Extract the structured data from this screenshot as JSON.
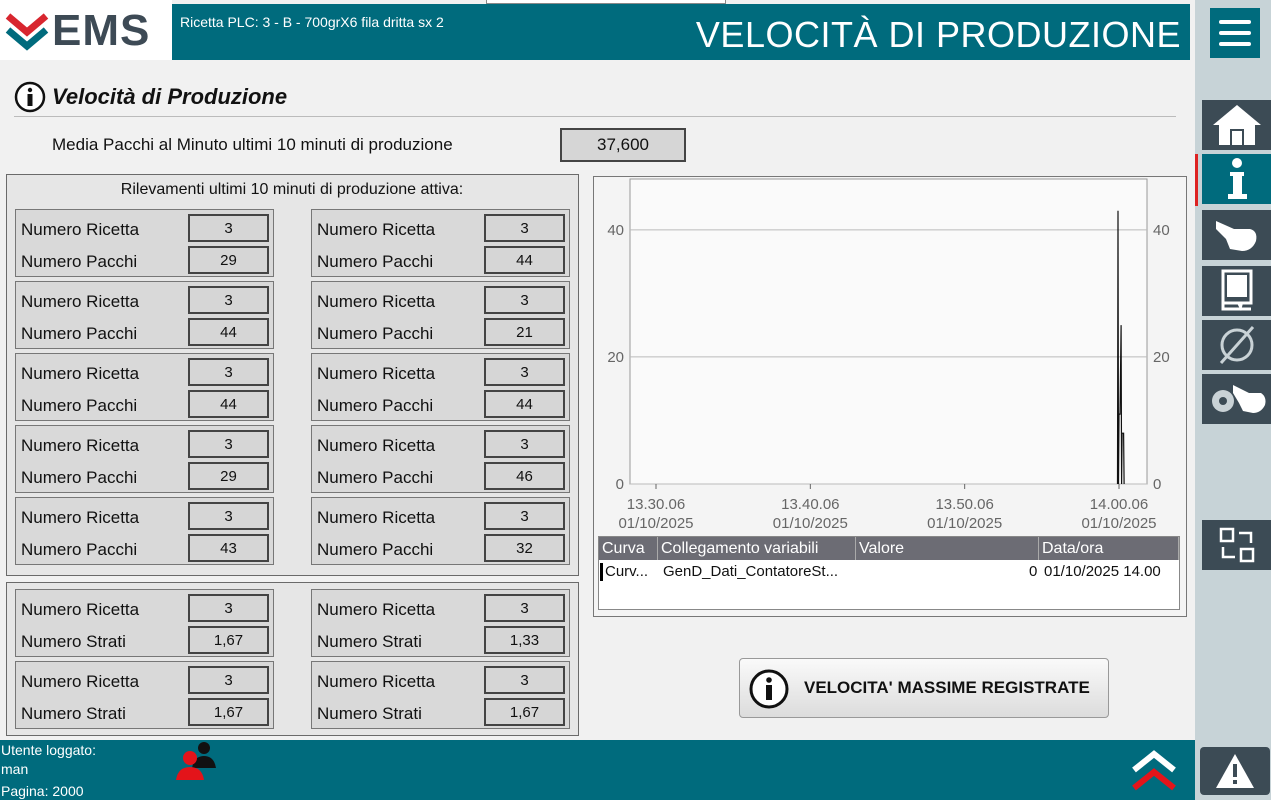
{
  "header": {
    "logo_text": "EMS",
    "recipe_info": "Ricetta PLC: 3 - B - 700grX6 fila dritta sx 2",
    "page_title": "VELOCITÀ DI PRODUZIONE"
  },
  "section": {
    "title": "Velocità di Produzione",
    "avg_label": "Media Pacchi al Minuto ultimi 10 minuti di produzione",
    "avg_value": "37,600",
    "panel_title": "Rilevamenti ultimi 10 minuti di produzione attiva:"
  },
  "records": [
    {
      "recipe_label": "Numero Ricetta",
      "recipe": "3",
      "count_label": "Numero Pacchi",
      "count": "29"
    },
    {
      "recipe_label": "Numero Ricetta",
      "recipe": "3",
      "count_label": "Numero Pacchi",
      "count": "44"
    },
    {
      "recipe_label": "Numero Ricetta",
      "recipe": "3",
      "count_label": "Numero Pacchi",
      "count": "44"
    },
    {
      "recipe_label": "Numero Ricetta",
      "recipe": "3",
      "count_label": "Numero Pacchi",
      "count": "21"
    },
    {
      "recipe_label": "Numero Ricetta",
      "recipe": "3",
      "count_label": "Numero Pacchi",
      "count": "44"
    },
    {
      "recipe_label": "Numero Ricetta",
      "recipe": "3",
      "count_label": "Numero Pacchi",
      "count": "44"
    },
    {
      "recipe_label": "Numero Ricetta",
      "recipe": "3",
      "count_label": "Numero Pacchi",
      "count": "29"
    },
    {
      "recipe_label": "Numero Ricetta",
      "recipe": "3",
      "count_label": "Numero Pacchi",
      "count": "46"
    },
    {
      "recipe_label": "Numero Ricetta",
      "recipe": "3",
      "count_label": "Numero Pacchi",
      "count": "43"
    },
    {
      "recipe_label": "Numero Ricetta",
      "recipe": "3",
      "count_label": "Numero Pacchi",
      "count": "32"
    }
  ],
  "layers": [
    {
      "recipe_label": "Numero Ricetta",
      "recipe": "3",
      "count_label": "Numero Strati",
      "count": "1,67"
    },
    {
      "recipe_label": "Numero Ricetta",
      "recipe": "3",
      "count_label": "Numero Strati",
      "count": "1,33"
    },
    {
      "recipe_label": "Numero Ricetta",
      "recipe": "3",
      "count_label": "Numero Strati",
      "count": "1,67"
    },
    {
      "recipe_label": "Numero Ricetta",
      "recipe": "3",
      "count_label": "Numero Strati",
      "count": "1,67"
    }
  ],
  "chart_data": {
    "type": "line",
    "x_ticks": [
      {
        "time": "13.30.06",
        "date": "01/10/2025"
      },
      {
        "time": "13.40.06",
        "date": "01/10/2025"
      },
      {
        "time": "13.50.06",
        "date": "01/10/2025"
      },
      {
        "time": "14.00.06",
        "date": "01/10/2025"
      }
    ],
    "y_ticks": [
      "0",
      "20",
      "40"
    ],
    "ylim": [
      0,
      48
    ],
    "grid": true,
    "series": [
      {
        "points": [
          [
            "14.00.00",
            0
          ],
          [
            "14.00.02",
            43
          ],
          [
            "14.00.04",
            0
          ],
          [
            "14.00.06",
            11
          ],
          [
            "14.00.10",
            11
          ],
          [
            "14.00.14",
            25
          ],
          [
            "14.00.16",
            0
          ],
          [
            "14.00.18",
            8
          ],
          [
            "14.00.24",
            8
          ],
          [
            "14.00.26",
            0
          ]
        ]
      }
    ]
  },
  "legend": {
    "headers": [
      "Curva",
      "Collegamento variabili",
      "Valore",
      "Data/ora"
    ],
    "row": {
      "curve": "Curv...",
      "link": "GenD_Dati_ContatoreSt...",
      "value": "0",
      "datetime": "01/10/2025 14.00"
    }
  },
  "max_button_label": "VELOCITA' MASSIME REGISTRATE",
  "footer": {
    "user_label": "Utente loggato:",
    "user": "man",
    "page_label": "Pagina: 2000"
  },
  "colors": {
    "accent": "#006b7d",
    "sidebar_button": "#3c4b55",
    "logo_red": "#d8262f",
    "logo_teal": "#006b7d"
  }
}
